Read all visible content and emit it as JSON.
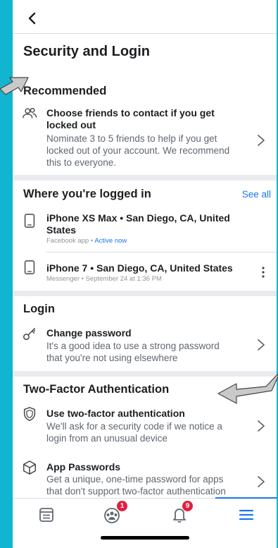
{
  "page": {
    "title": "Security and Login"
  },
  "recommended": {
    "header": "Recommended",
    "item": {
      "title": "Choose friends to contact if you get locked out",
      "title_line1": "Choose friends to contact if you get",
      "title_line2": "locked out",
      "sub_line1": "Nominate 3 to 5 friends to help if you get",
      "sub_line2": "locked out of your account. We recommend",
      "sub_line3": "this to everyone."
    }
  },
  "logged_in": {
    "header": "Where you're logged in",
    "see_all": "See all",
    "devices": [
      {
        "title_line1": "iPhone XS Max • San Diego, CA, United",
        "title_line2": "States",
        "meta_app": "Facebook app",
        "meta_sep": " • ",
        "meta_status": "Active now"
      },
      {
        "title_line1": "iPhone 7 • San Diego, CA, United States",
        "meta": "Messenger • September 24 at 1:36 PM"
      }
    ]
  },
  "login": {
    "header": "Login",
    "change_password": {
      "title": "Change password",
      "sub_line1": "It's a good idea to use a strong password",
      "sub_line2": "that you're not using elsewhere"
    }
  },
  "two_factor": {
    "header": "Two-Factor Authentication",
    "use_2fa": {
      "title": "Use two-factor authentication",
      "sub_line1": "We'll ask for a security code if we notice a",
      "sub_line2": "login from an unusual device"
    },
    "app_passwords": {
      "title": "App Passwords",
      "sub_line1": "Get a unique, one-time password for apps",
      "sub_line2": "that don't support two-factor authentication"
    }
  },
  "nav": {
    "groups_badge": "1",
    "notifications_badge": "9"
  },
  "colors": {
    "accent": "#1877f2",
    "badge": "#e41e3f",
    "background": "#12b5cf"
  },
  "icons": [
    "back-icon",
    "friends-icon",
    "phone-icon",
    "more-icon",
    "key-icon",
    "shield-icon",
    "cube-icon",
    "chevron-right-icon",
    "feed-icon",
    "groups-icon",
    "bell-icon",
    "menu-icon"
  ]
}
